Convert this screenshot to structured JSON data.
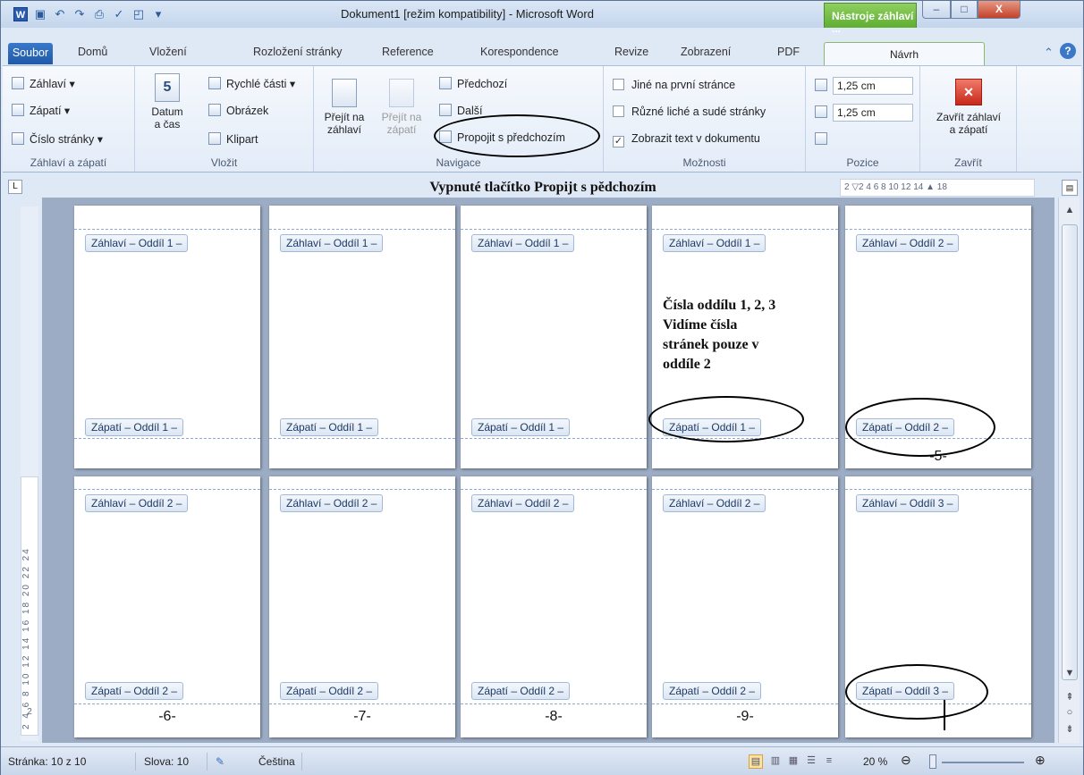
{
  "titlebar": {
    "title": "Dokument1 [režim kompatibility] - Microsoft Word",
    "context_tab": "Nástroje záhlaví ...",
    "min": "–",
    "max": "□",
    "close": "X"
  },
  "tabs": {
    "file": "Soubor",
    "items": [
      "Domů",
      "Vložení",
      "Rozložení stránky",
      "Reference",
      "Korespondence",
      "Revize",
      "Zobrazení",
      "PDF"
    ],
    "active": "Návrh"
  },
  "ribbon": {
    "hf": {
      "header": "Záhlaví ▾",
      "footer": "Zápatí ▾",
      "pagenum": "Číslo stránky ▾",
      "label": "Záhlaví a zápatí"
    },
    "insert": {
      "date_line1": "Datum",
      "date_line2": "a čas",
      "date_icon": "5",
      "quick": "Rychlé části ▾",
      "picture": "Obrázek",
      "clipart": "Klipart",
      "label": "Vložit"
    },
    "nav": {
      "goto_header_1": "Přejít na",
      "goto_header_2": "záhlaví",
      "goto_footer_1": "Přejít na",
      "goto_footer_2": "zápatí",
      "prev": "Předchozí",
      "next": "Další",
      "link": "Propojit s předchozím",
      "label": "Navigace"
    },
    "options": {
      "first": "Jiné na první stránce",
      "oddeven": "Různé liché a sudé stránky",
      "showtext": "Zobrazit text v dokumentu",
      "label": "Možnosti"
    },
    "position": {
      "top": "1,25 cm",
      "bottom": "1,25 cm",
      "label": "Pozice"
    },
    "close": {
      "line1": "Zavřít záhlaví",
      "line2": "a zápatí",
      "label": "Zavřít"
    }
  },
  "doc": {
    "heading": "Vypnuté tlačítko Propijt s pědchozím",
    "hruler": "2 ▽2 4 6 8 10 12 14 ▲ 18",
    "vruler": "2 4 6 8 10 12 14 16 18 20 22 24",
    "vruler_bottom": "2",
    "ruler_corner": "L",
    "annotation": [
      "Čísla oddílu 1, 2, 3",
      "Vidíme čísla",
      "stránek pouze v",
      "oddíle 2"
    ],
    "row1": [
      {
        "header": "Záhlaví – Oddíl 1 –",
        "footer": "Zápatí – Oddíl 1 –",
        "num": ""
      },
      {
        "header": "Záhlaví – Oddíl 1 –",
        "footer": "Zápatí – Oddíl 1 –",
        "num": ""
      },
      {
        "header": "Záhlaví – Oddíl 1 –",
        "footer": "Zápatí – Oddíl 1 –",
        "num": ""
      },
      {
        "header": "Záhlaví – Oddíl 1 –",
        "footer": "Zápatí – Oddíl 1 –",
        "num": ""
      },
      {
        "header": "Záhlaví – Oddíl 2 –",
        "footer": "Zápatí – Oddíl 2 –",
        "num": "-5-"
      }
    ],
    "row2": [
      {
        "header": "Záhlaví – Oddíl 2 –",
        "footer": "Zápatí – Oddíl 2 –",
        "num": "-6-"
      },
      {
        "header": "Záhlaví – Oddíl 2 –",
        "footer": "Zápatí – Oddíl 2 –",
        "num": "-7-"
      },
      {
        "header": "Záhlaví – Oddíl 2 –",
        "footer": "Zápatí – Oddíl 2 –",
        "num": "-8-"
      },
      {
        "header": "Záhlaví – Oddíl 2 –",
        "footer": "Zápatí – Oddíl 2 –",
        "num": "-9-"
      },
      {
        "header": "Záhlaví – Oddíl 3 –",
        "footer": "Zápatí – Oddíl 3 –",
        "num": ""
      }
    ]
  },
  "status": {
    "page": "Stránka: 10 z 10",
    "words": "Slova: 10",
    "lang": "Čeština",
    "zoom": "20 %",
    "zoom_level": 0.2
  },
  "colors": {
    "accent": "#2a5bb0",
    "context": "#5fae32",
    "close": "#c8281a"
  },
  "icons": [
    "word-icon",
    "save-icon",
    "undo-icon",
    "redo-icon",
    "print-icon",
    "spellcheck-icon",
    "preview-icon",
    "help-icon",
    "minimize-icon"
  ]
}
